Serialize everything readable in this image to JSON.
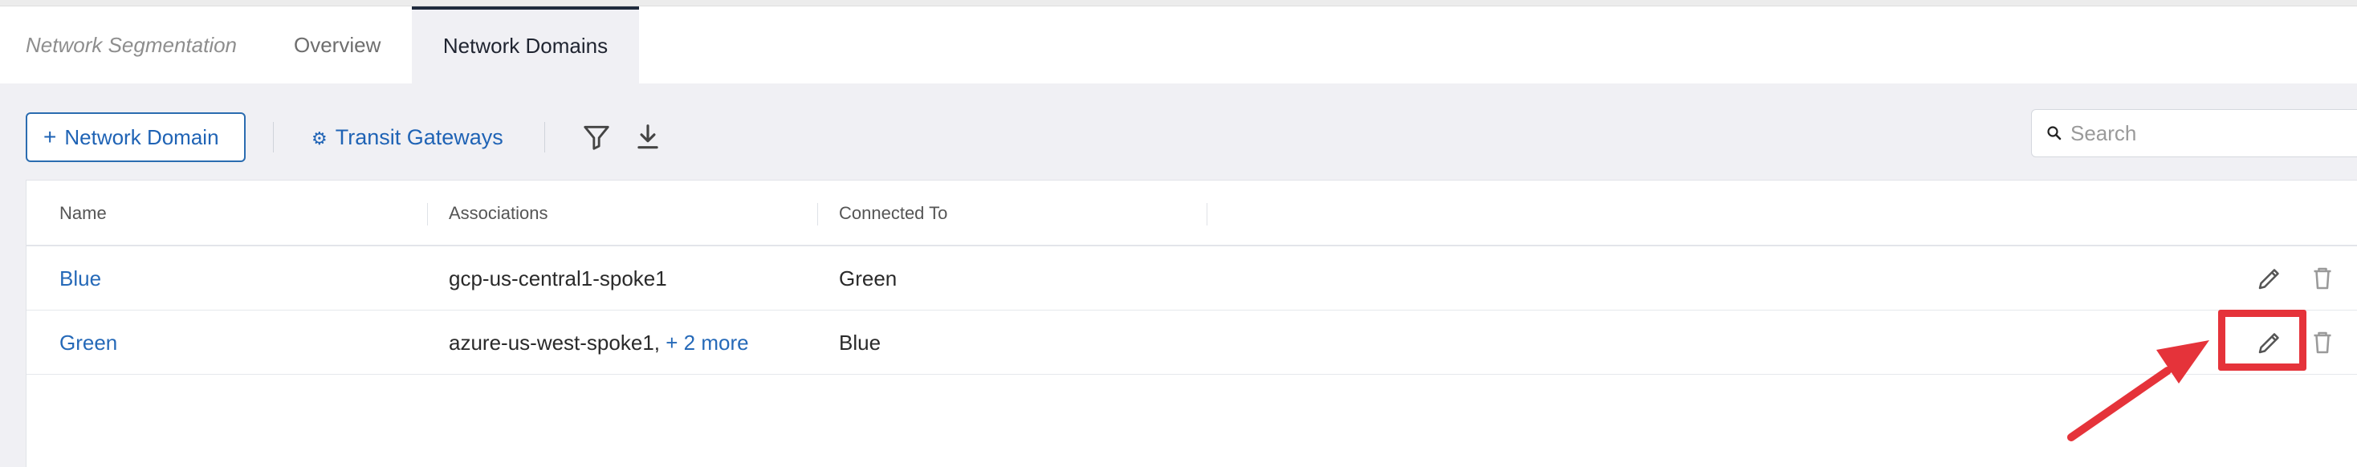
{
  "tabs": {
    "breadcrumb": "Network Segmentation",
    "overview": "Overview",
    "active": "Network Domains"
  },
  "toolbar": {
    "add_label": "Network Domain",
    "add_icon": "+",
    "transit_label": "Transit Gateways",
    "transit_icon": "gear-icon"
  },
  "search": {
    "placeholder": "Search"
  },
  "table": {
    "columns": [
      "Name",
      "Associations",
      "Connected To"
    ],
    "rows": [
      {
        "name": "Blue",
        "associations": "gcp-us-central1-spoke1",
        "more": "",
        "connected_to": "Green"
      },
      {
        "name": "Green",
        "associations": "azure-us-west-spoke1,",
        "more": "+ 2 more",
        "connected_to": "Blue"
      }
    ]
  },
  "colors": {
    "accent": "#2569b8",
    "annotation": "#e5333a",
    "active_tab_border": "#1f2a3c"
  }
}
